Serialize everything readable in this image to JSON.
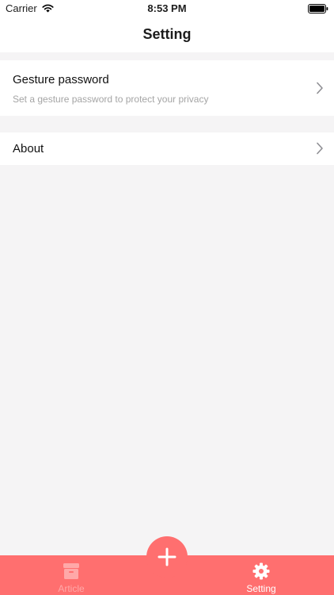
{
  "status_bar": {
    "carrier": "Carrier",
    "time": "8:53 PM"
  },
  "nav": {
    "title": "Setting"
  },
  "settings": {
    "gesture": {
      "title": "Gesture password",
      "subtitle": "Set a gesture password to protect your privacy"
    },
    "about": {
      "title": "About"
    }
  },
  "tab_bar": {
    "tabs": [
      {
        "label": "Article",
        "icon": "archive-box-icon",
        "selected": false
      },
      {
        "label": "Setting",
        "icon": "gear-icon",
        "selected": true
      }
    ],
    "center_button_icon": "plus-icon"
  },
  "colors": {
    "accent": "#ff6f6f",
    "background": "#f5f4f5",
    "subtitle": "#a5a5a5",
    "tab_inactive": "#ffa8a8"
  }
}
